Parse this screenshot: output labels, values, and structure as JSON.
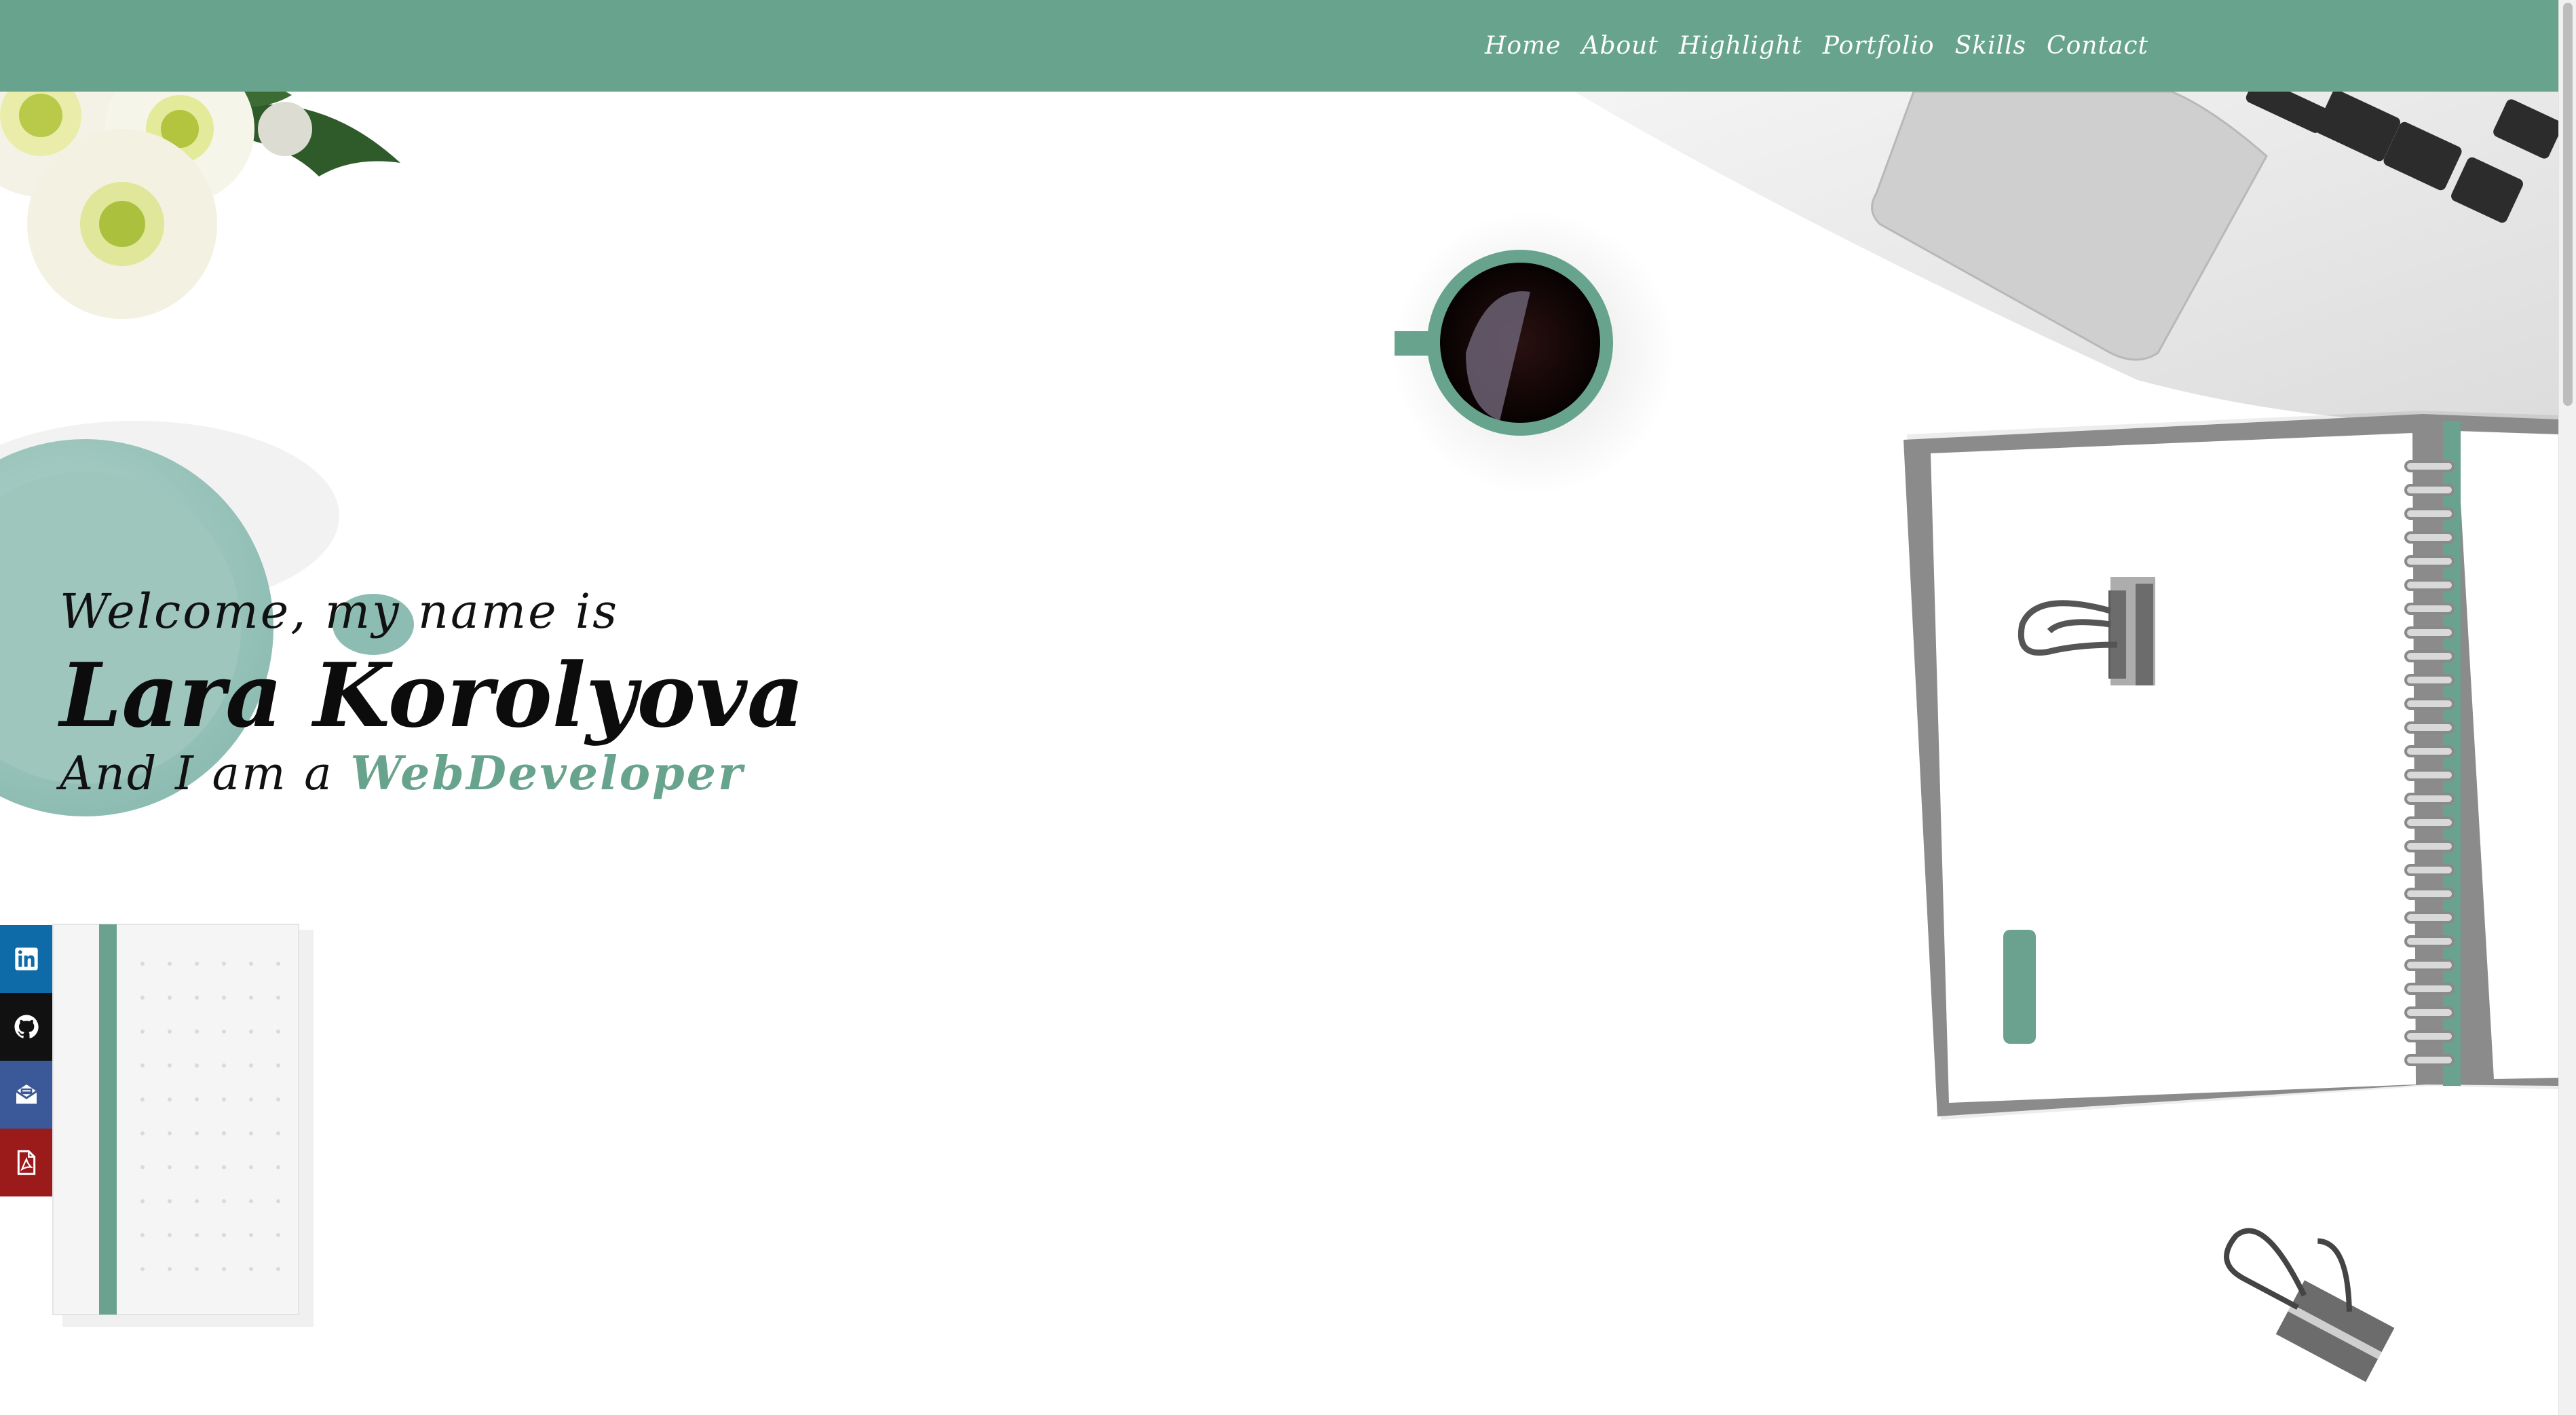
{
  "nav": {
    "links": [
      "Home",
      "About",
      "Highlight",
      "Portfolio",
      "Skills",
      "Contact"
    ]
  },
  "hero": {
    "welcome": "Welcome, my name is",
    "name": "Lara Korolyova",
    "role_prefix": "And I am a",
    "role": "WebDeveloper"
  },
  "social": [
    {
      "icon": "linkedin-icon",
      "color": "#0e6ba8"
    },
    {
      "icon": "github-icon",
      "color": "#111111"
    },
    {
      "icon": "mail-icon",
      "color": "#3b5998"
    },
    {
      "icon": "pdf-icon",
      "color": "#9b1b1b"
    }
  ],
  "colors": {
    "accent": "#68a48d",
    "navbar": "#68a48d"
  }
}
